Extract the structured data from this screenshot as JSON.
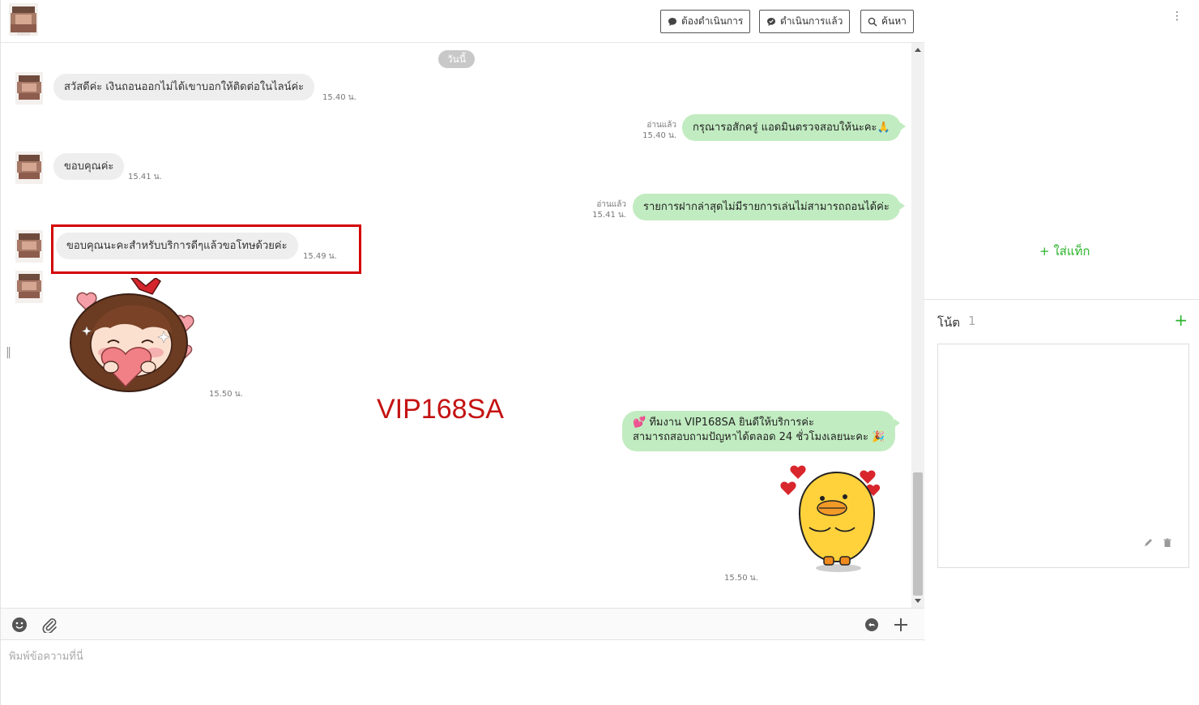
{
  "header": {
    "actions": [
      {
        "label": "ต้องดำเนินการ",
        "icon": "chat-bubble-icon"
      },
      {
        "label": "ดำเนินการแล้ว",
        "icon": "chat-check-icon"
      },
      {
        "label": "ค้นหา",
        "icon": "search-icon"
      }
    ]
  },
  "chat": {
    "day_label": "วันนี้",
    "messages": [
      {
        "direction": "in",
        "text": "สวัสดีค่ะ เงินถอนออกไม่ได้เขาบอกให้ติดต่อในไลน์ค่ะ",
        "time": "15.40 น."
      },
      {
        "direction": "out",
        "text": "กรุณารอสักครู่ แอดมินตรวจสอบให้นะคะ🙏",
        "read": "อ่านแล้ว",
        "time": "15.40 น."
      },
      {
        "direction": "in",
        "text": "ขอบคุณค่ะ",
        "time": "15.41 น."
      },
      {
        "direction": "out",
        "text": "รายการฝากล่าสุดไม่มีรายการเล่นไม่สามารถถอนได้ค่ะ",
        "read": "อ่านแล้ว",
        "time": "15.41 น."
      },
      {
        "direction": "in",
        "text": "ขอบคุณนะคะสำหรับบริการดีๆแล้วขอโทษด้วยค่ะ",
        "time": "15.49 น.",
        "highlighted": true
      },
      {
        "direction": "in",
        "type": "sticker",
        "sticker": "girl-hugging-heart-sticker",
        "time": "15.50 น."
      },
      {
        "direction": "out",
        "lines": [
          "💕 ทีมงาน VIP168SA ยินดีให้บริการค่ะ",
          "สามารถสอบถามปัญหาได้ตลอด 24 ชั่วโมงเลยนะคะ 🎉"
        ]
      },
      {
        "direction": "out",
        "type": "sticker",
        "sticker": "yellow-duck-hearts-sticker",
        "time": "15.50 น."
      }
    ],
    "watermark": "VIP168SA"
  },
  "composer": {
    "placeholder": "พิมพ์ข้อความที่นี่"
  },
  "side": {
    "add_tag_label": "+ ใส่แท็ก",
    "notes_title": "โน้ต",
    "notes_count": "1",
    "add_note_label": "+"
  },
  "colors": {
    "incoming_bubble": "#eeeeee",
    "outgoing_bubble": "#c1ecc1",
    "accent_green": "#2bb32b",
    "highlight_red": "#d40000",
    "watermark_red": "#c41212"
  }
}
